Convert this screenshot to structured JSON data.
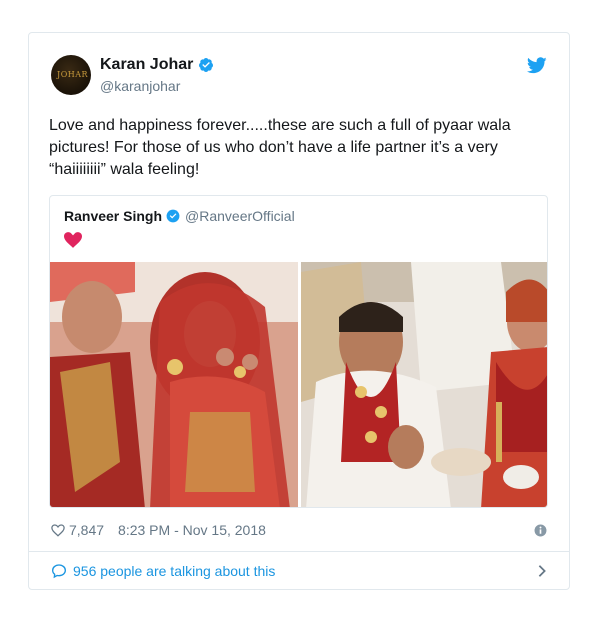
{
  "tweet": {
    "author": {
      "display_name": "Karan Johar",
      "handle": "@karanjohar",
      "avatar_text": "JOHAR",
      "verified": true
    },
    "text": "Love and happiness forever.....these are such a full of pyaar wala pictures! For those of us who don’t have a life partner it’s a very “haiiiiiiii” wala feeling!",
    "quoted": {
      "display_name": "Ranveer Singh",
      "handle": "@RanveerOfficial",
      "verified": true,
      "emoji": "red-heart-icon",
      "photos": [
        "wedding-photo-left",
        "wedding-photo-right"
      ]
    },
    "likes": "7,847",
    "timestamp": "8:23 PM - Nov 15, 2018",
    "talking": "956 people are talking about this"
  },
  "colors": {
    "twitter_blue": "#1da1f2",
    "link_blue": "#1b95e0",
    "muted": "#657786",
    "heart_red": "#e0245e"
  },
  "icons": {
    "brand": "twitter-bird-icon",
    "verified": "verified-badge-icon",
    "like": "heart-outline-icon",
    "info": "info-icon",
    "reply": "speech-bubble-icon",
    "more": "chevron-right-icon"
  }
}
